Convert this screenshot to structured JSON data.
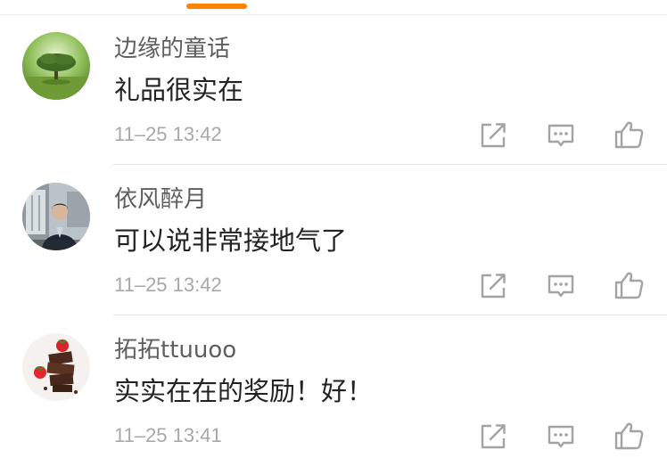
{
  "colors": {
    "accent": "#ff8200",
    "username": "#5e5e5e",
    "content": "#222222",
    "timestamp": "#a8a8a8",
    "icon": "#a3a3a3",
    "divider": "#e3e3e3"
  },
  "comments": [
    {
      "username": "边缘的童话",
      "content": "礼品很实在",
      "timestamp": "11–25 13:42",
      "avatar_icon": "lone-tree-avatar"
    },
    {
      "username": "依风醉月",
      "content": "可以说非常接地气了",
      "timestamp": "11–25 13:42",
      "avatar_icon": "man-by-window-avatar"
    },
    {
      "username": "拓拓ttuuoo",
      "content": "实实在在的奖励！好！",
      "timestamp": "11–25 13:41",
      "avatar_icon": "chocolate-strawberry-avatar"
    }
  ],
  "actions": {
    "share_icon": "share-icon",
    "comment_icon": "comment-icon",
    "like_icon": "thumbs-up-icon"
  }
}
